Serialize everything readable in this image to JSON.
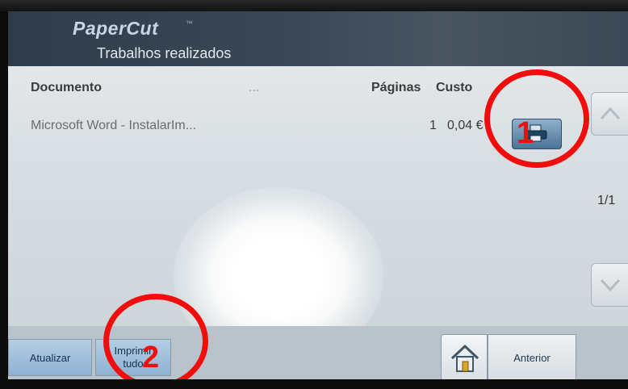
{
  "header": {
    "brand": "PaperCut",
    "brand_mark": "™",
    "subtitle": "Trabalhos realizados"
  },
  "table": {
    "columns": [
      "Documento",
      "...",
      "Páginas",
      "Custo"
    ],
    "rows": [
      {
        "document": "Microsoft Word - InstalarIm...",
        "pages": "1",
        "cost": "0,04 €"
      }
    ]
  },
  "pagination": {
    "indicator": "1/1"
  },
  "bottom_bar": {
    "refresh_label": "Atualizar",
    "print_all_label": "Imprimir tudo",
    "print_all_line1": "Imprimir",
    "print_all_line2": "tudo",
    "back_label": "Anterior"
  },
  "annotations": [
    {
      "number": "1"
    },
    {
      "number": "2"
    }
  ],
  "icons": [
    "printer-icon",
    "arrow-up-icon",
    "arrow-down-icon",
    "home-icon"
  ],
  "colors": {
    "annotation": "#f20d0d",
    "button_blue": "#8fb1d1",
    "header": "#2f3d4b"
  }
}
